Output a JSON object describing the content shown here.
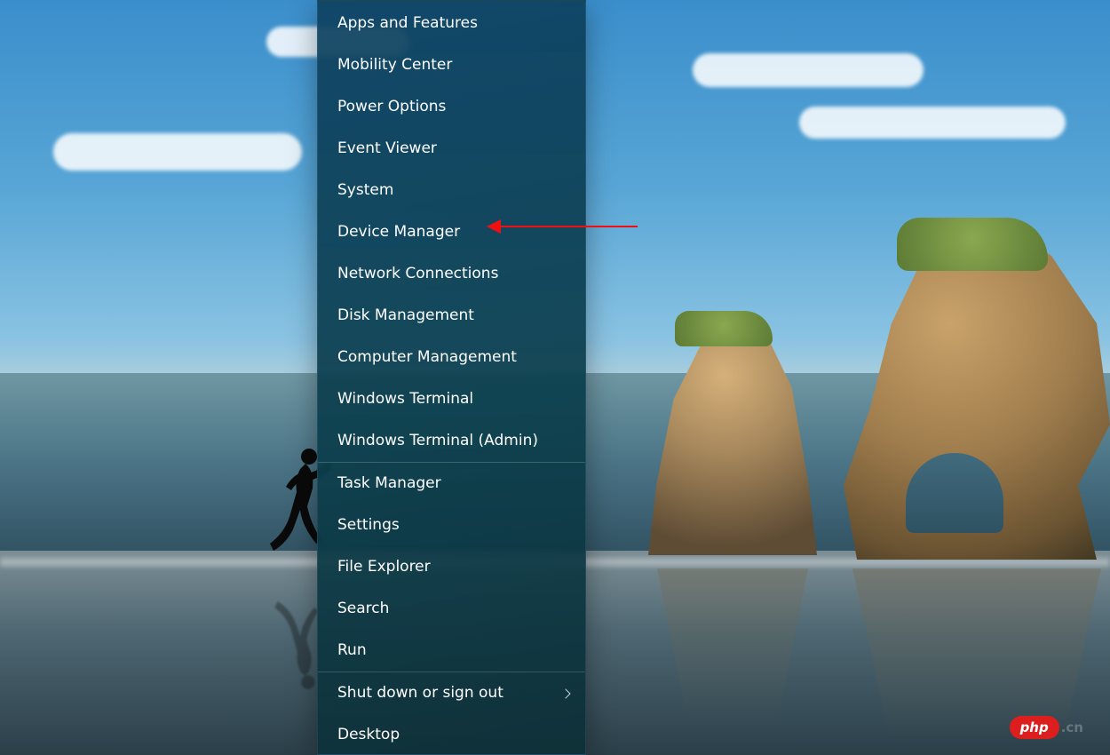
{
  "menu": {
    "groups": [
      [
        {
          "id": "apps-and-features",
          "label": "Apps and Features"
        },
        {
          "id": "mobility-center",
          "label": "Mobility Center"
        },
        {
          "id": "power-options",
          "label": "Power Options"
        },
        {
          "id": "event-viewer",
          "label": "Event Viewer"
        },
        {
          "id": "system",
          "label": "System"
        },
        {
          "id": "device-manager",
          "label": "Device Manager"
        },
        {
          "id": "network-connections",
          "label": "Network Connections"
        },
        {
          "id": "disk-management",
          "label": "Disk Management"
        },
        {
          "id": "computer-management",
          "label": "Computer Management"
        },
        {
          "id": "windows-terminal",
          "label": "Windows Terminal"
        },
        {
          "id": "windows-terminal-admin",
          "label": "Windows Terminal (Admin)"
        }
      ],
      [
        {
          "id": "task-manager",
          "label": "Task Manager"
        },
        {
          "id": "settings",
          "label": "Settings"
        },
        {
          "id": "file-explorer",
          "label": "File Explorer"
        },
        {
          "id": "search",
          "label": "Search"
        },
        {
          "id": "run",
          "label": "Run"
        }
      ],
      [
        {
          "id": "shut-down-or-sign-out",
          "label": "Shut down or sign out",
          "submenu": true
        },
        {
          "id": "desktop",
          "label": "Desktop"
        }
      ]
    ]
  },
  "annotation": {
    "target_item_id": "device-manager",
    "arrow_color": "#e11"
  },
  "watermark": {
    "brand": "php",
    "suffix": ".cn"
  }
}
